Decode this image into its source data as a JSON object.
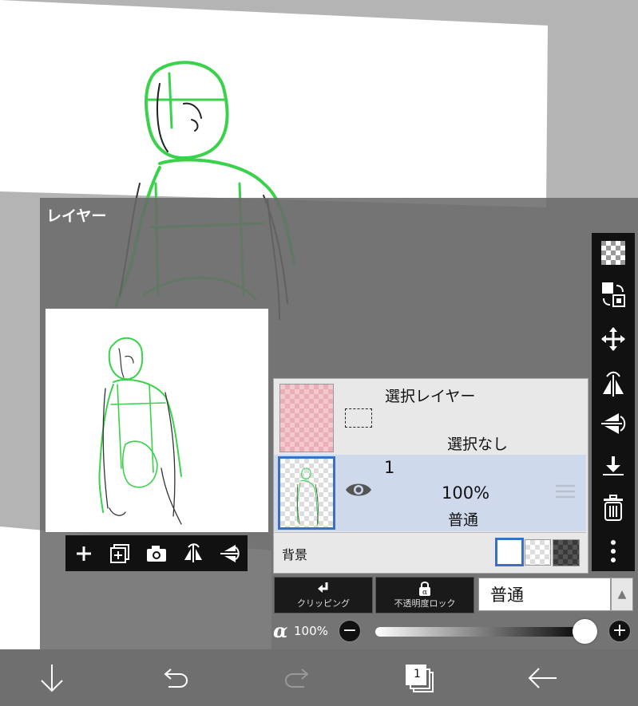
{
  "panel": {
    "title": "レイヤー"
  },
  "selection_layer": {
    "title": "選択レイヤー",
    "status": "選択なし"
  },
  "layers": [
    {
      "number": "1",
      "opacity": "100%",
      "blend_mode": "普通",
      "visible": true
    }
  ],
  "background_row": {
    "label": "背景",
    "options": [
      "white",
      "checker-light",
      "checker-dark"
    ],
    "selected": "white"
  },
  "buttons": {
    "clipping_label": "クリッピング",
    "opacity_lock_label": "不透明度ロック"
  },
  "blend_select": {
    "value": "普通"
  },
  "alpha": {
    "symbol": "α",
    "value_text": "100%",
    "value": 1.0
  },
  "preview_tools": [
    "add-layer-icon",
    "add-layer-copy-icon",
    "camera-icon",
    "flip-horizontal-icon",
    "flip-vertical-icon"
  ],
  "right_tools": [
    "transparency-icon",
    "move-layer-icon",
    "move-icon",
    "flip-horizontal-icon",
    "flip-vertical-icon",
    "merge-down-icon",
    "trash-icon",
    "more-icon"
  ],
  "bottom_bar": {
    "page_count": "1"
  },
  "colors": {
    "accent_blue": "#3a6fc4",
    "sketch_green": "#39d24a",
    "selected_row": "#cfd9ec"
  }
}
